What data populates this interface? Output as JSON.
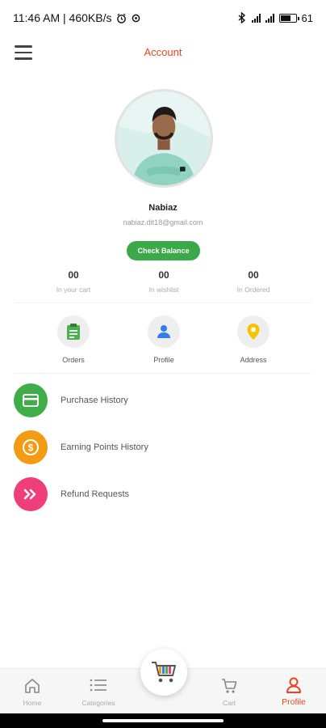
{
  "status_bar": {
    "time_speed": "11:46 AM | 460KB/s",
    "battery": "61"
  },
  "header": {
    "title": "Account"
  },
  "profile": {
    "name": "Nabiaz",
    "email": "nabiaz.dit18@gmail.com",
    "check_balance_label": "Check Balance"
  },
  "stats": [
    {
      "value": "00",
      "label": "In your cart"
    },
    {
      "value": "00",
      "label": "In wishlist"
    },
    {
      "value": "00",
      "label": "In Ordered"
    }
  ],
  "quick_actions": [
    {
      "label": "Orders",
      "icon": "clipboard-icon",
      "color": "#4caf50"
    },
    {
      "label": "Profile",
      "icon": "person-icon",
      "color": "#2f80ed"
    },
    {
      "label": "Address",
      "icon": "location-pin-icon",
      "color": "#f5c400"
    }
  ],
  "menu": [
    {
      "label": "Purchase History",
      "icon": "credit-card-icon",
      "color": "#3fae49"
    },
    {
      "label": "Earning Points History",
      "icon": "dollar-coin-icon",
      "color": "#f39b12"
    },
    {
      "label": "Refund Requests",
      "icon": "double-chevron-right-icon",
      "color": "#ef3e7a"
    }
  ],
  "bottom_nav": {
    "home": "Home",
    "categories": "Categories",
    "cart": "Cart",
    "profile": "Profile",
    "active": "Profile",
    "active_color": "#e8461e"
  },
  "colors": {
    "accent": "#e8461e",
    "balance_button": "#3ba94a"
  }
}
